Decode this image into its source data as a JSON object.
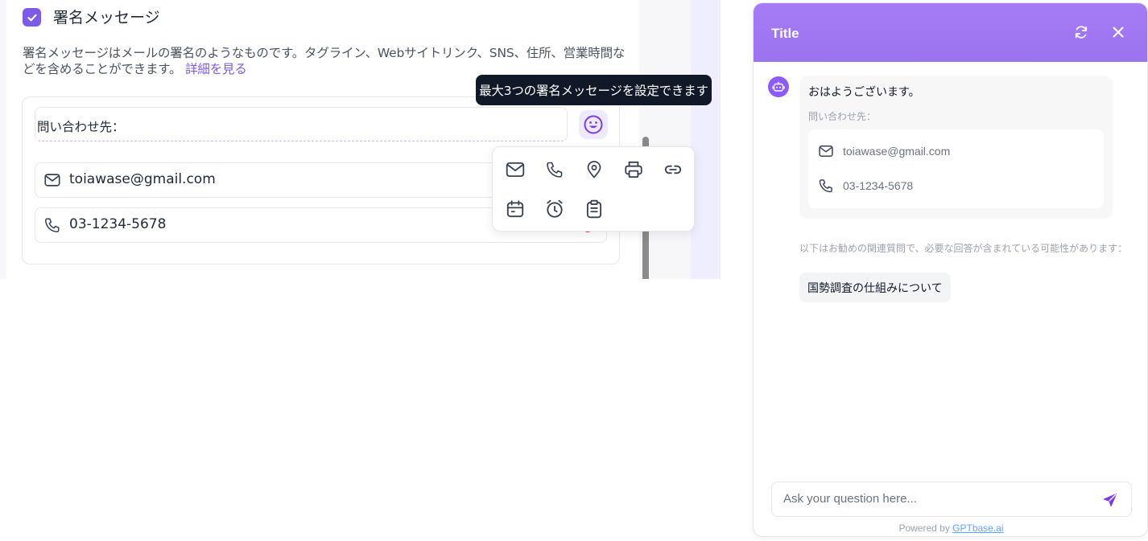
{
  "signature": {
    "enabled": true,
    "title": "署名メッセージ",
    "description": "署名メッセージはメールの署名のようなものです。タグライン、Webサイトリンク、SNS、住所、営業時間などを含めることができます。",
    "learn_more": "詳細を見る",
    "header_text": "問い合わせ先：",
    "tooltip": "最大3つの署名メッセージを設定できます",
    "rows": [
      {
        "icon": "mail-icon",
        "text": "toiawase@gmail.com"
      },
      {
        "icon": "phone-icon",
        "text": "03-1234-5678"
      }
    ],
    "picker_icons": [
      "mail-icon",
      "phone-icon",
      "location-pin-icon",
      "printer-icon",
      "link-icon",
      "calendar-icon",
      "alarm-clock-icon",
      "clipboard-icon"
    ]
  },
  "chat": {
    "title": "Title",
    "accent": "#a77bf6",
    "greeting": "おはようございます。",
    "signature_header": "問い合わせ先：",
    "signature_email": "toiawase@gmail.com",
    "signature_phone": "03-1234-5678",
    "related_note": "以下はお勧めの関連質問で、必要な回答が含まれている可能性があります：",
    "related_questions": [
      "国勢調査の仕組みについて"
    ],
    "input_placeholder": "Ask your question here...",
    "powered_prefix": "Powered by ",
    "powered_link": "GPTbase.ai"
  }
}
